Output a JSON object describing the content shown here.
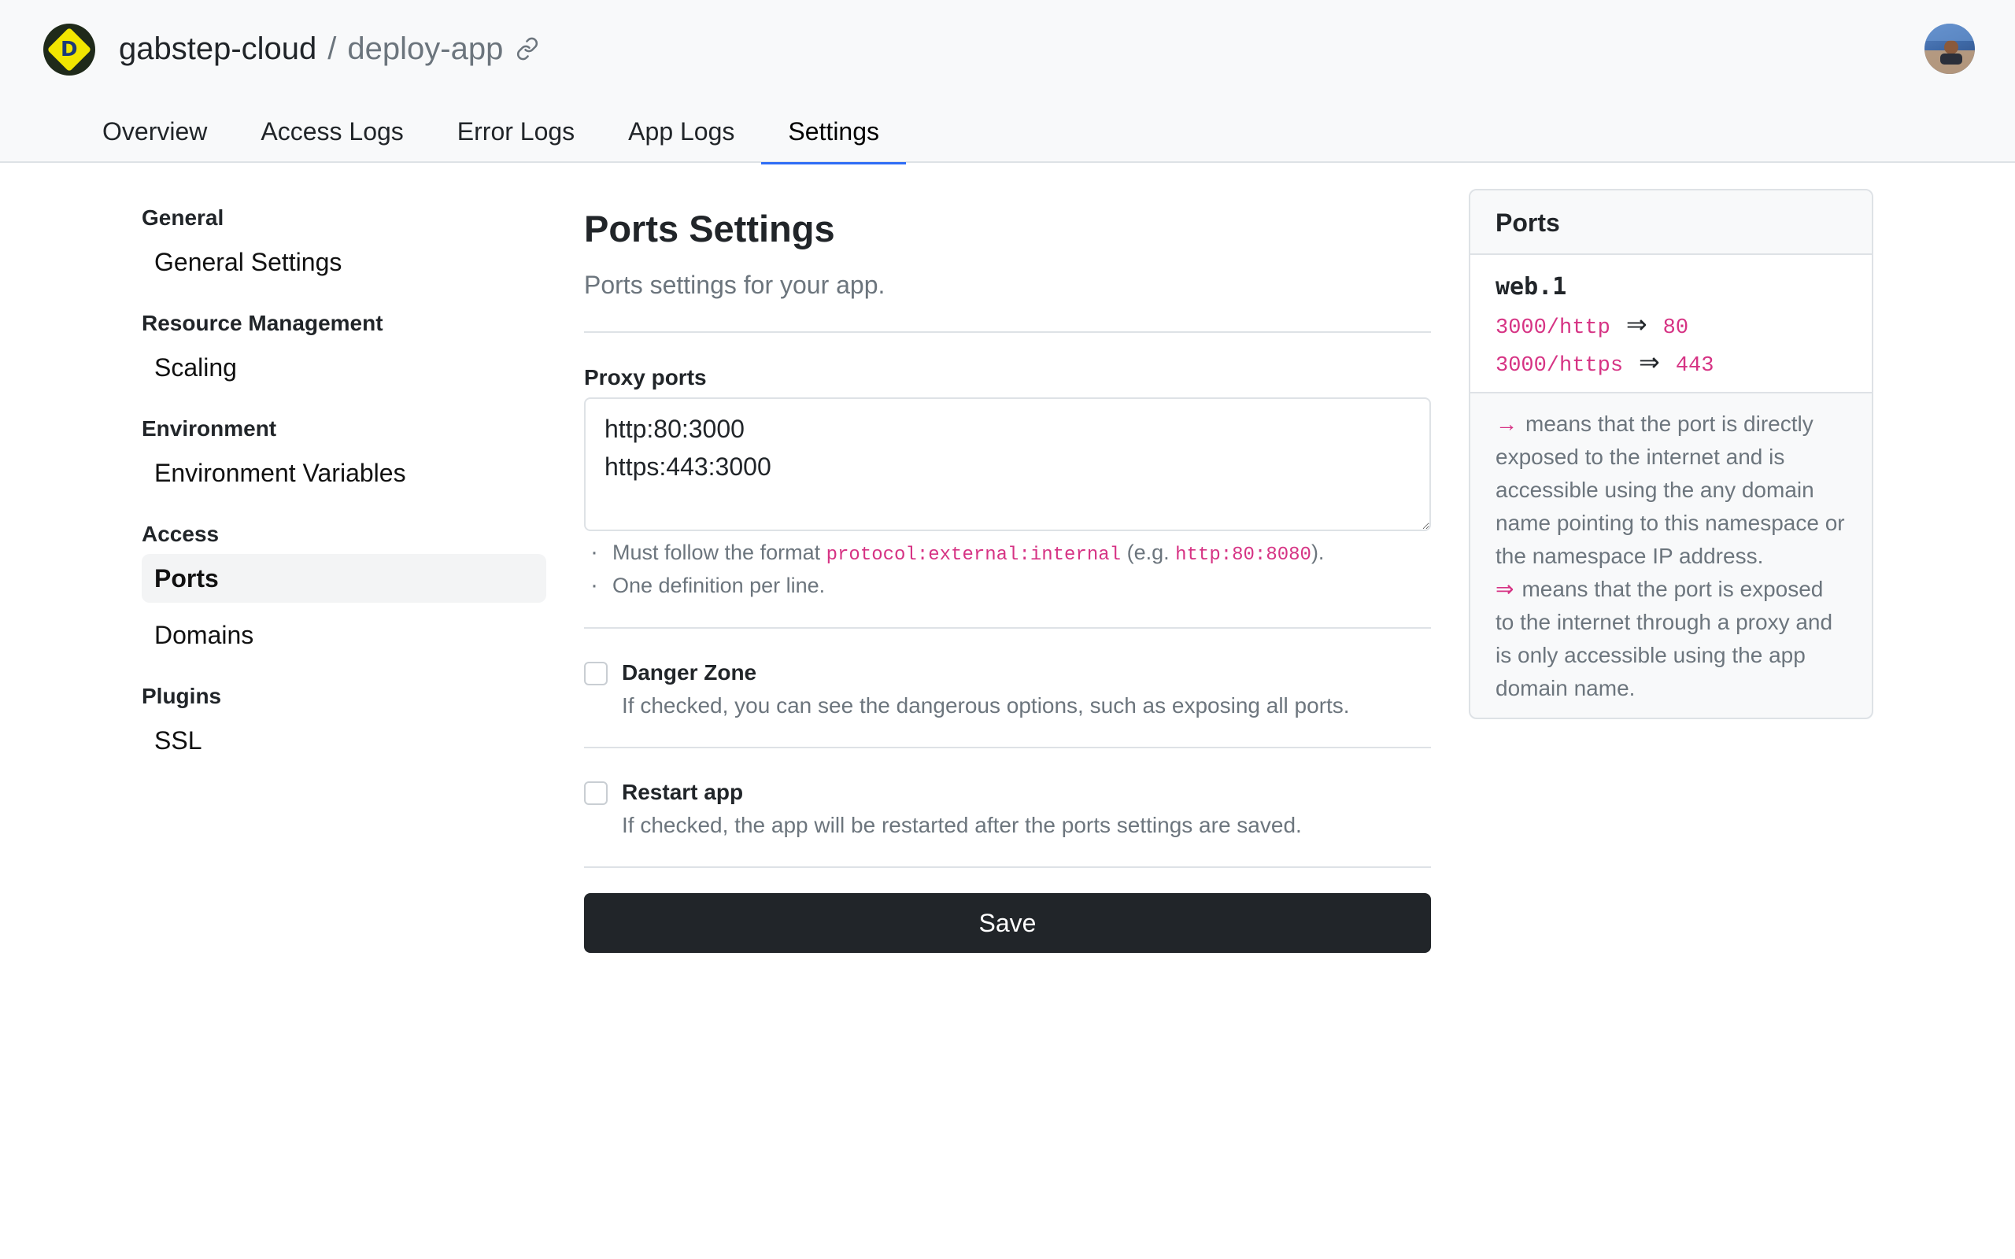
{
  "header": {
    "logo_letter": "D",
    "org": "gabstep-cloud",
    "separator": "/",
    "app": "deploy-app"
  },
  "tabs": [
    {
      "label": "Overview"
    },
    {
      "label": "Access Logs"
    },
    {
      "label": "Error Logs"
    },
    {
      "label": "App Logs"
    },
    {
      "label": "Settings",
      "active": true
    }
  ],
  "sidebar": {
    "groups": [
      {
        "heading": "General",
        "items": [
          {
            "label": "General Settings"
          }
        ]
      },
      {
        "heading": "Resource Management",
        "items": [
          {
            "label": "Scaling"
          }
        ]
      },
      {
        "heading": "Environment",
        "items": [
          {
            "label": "Environment Variables"
          }
        ]
      },
      {
        "heading": "Access",
        "items": [
          {
            "label": "Ports",
            "active": true
          },
          {
            "label": "Domains"
          }
        ]
      },
      {
        "heading": "Plugins",
        "items": [
          {
            "label": "SSL"
          }
        ]
      }
    ]
  },
  "main": {
    "title": "Ports Settings",
    "subtitle": "Ports settings for your app.",
    "proxy_label": "Proxy ports",
    "proxy_value": "http:80:3000\nhttps:443:3000",
    "hint1_pre": "Must follow the format ",
    "hint1_code1": "protocol:external:internal",
    "hint1_mid": " (e.g. ",
    "hint1_code2": "http:80:8080",
    "hint1_post": ").",
    "hint2": "One definition per line.",
    "danger_title": "Danger Zone",
    "danger_desc": "If checked, you can see the dangerous options, such as exposing all ports.",
    "danger_checked": false,
    "restart_title": "Restart app",
    "restart_desc": "If checked, the app will be restarted after the ports settings are saved.",
    "restart_checked": false,
    "save_label": "Save"
  },
  "ports_card": {
    "title": "Ports",
    "process": "web.1",
    "mappings": [
      {
        "src": "3000/http",
        "arrow": "⇒",
        "dst": "80"
      },
      {
        "src": "3000/https",
        "arrow": "⇒",
        "dst": "443"
      }
    ],
    "legend_direct_symbol": "→",
    "legend_direct": "means that the port is directly exposed to the internet and is accessible using the any domain name pointing to this namespace or the namespace IP address.",
    "legend_proxy_symbol": "⇒",
    "legend_proxy": "means that the port is exposed to the internet through a proxy and is only accessible using the app domain name."
  },
  "colors": {
    "accent": "#2f6df5",
    "code": "#d63384",
    "button": "#212529"
  },
  "icons": {
    "link": "link-icon",
    "logo": "logo-icon",
    "avatar": "user-avatar"
  }
}
